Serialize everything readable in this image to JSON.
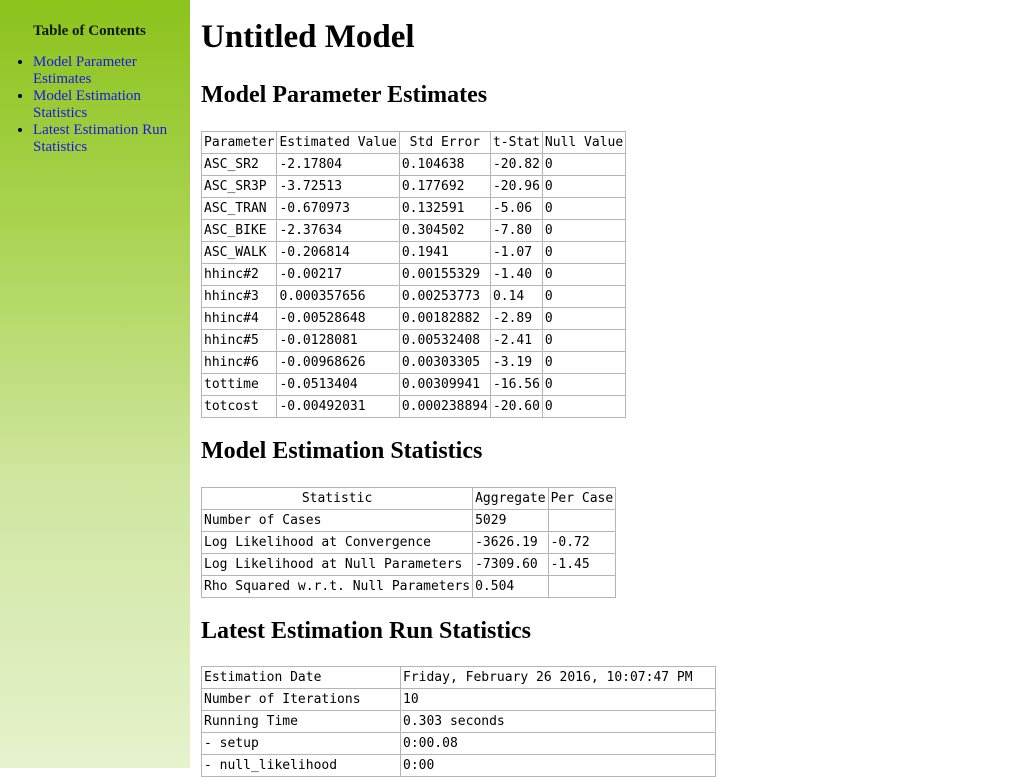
{
  "toc": {
    "title": "Table of Contents",
    "items": [
      {
        "label": "Model Parameter Estimates"
      },
      {
        "label": "Model Estimation Statistics"
      },
      {
        "label": "Latest Estimation Run Statistics"
      }
    ]
  },
  "page_title": "Untitled Model",
  "params": {
    "heading": "Model Parameter Estimates",
    "headers": [
      "Parameter",
      "Estimated Value",
      "Std Error",
      "t-Stat",
      "Null Value"
    ],
    "rows": [
      [
        "ASC_SR2",
        "-2.17804",
        "0.104638",
        "-20.82",
        "0"
      ],
      [
        "ASC_SR3P",
        "-3.72513",
        "0.177692",
        "-20.96",
        "0"
      ],
      [
        "ASC_TRAN",
        "-0.670973",
        "0.132591",
        "-5.06",
        "0"
      ],
      [
        "ASC_BIKE",
        "-2.37634",
        "0.304502",
        "-7.80",
        "0"
      ],
      [
        "ASC_WALK",
        "-0.206814",
        "0.1941",
        "-1.07",
        "0"
      ],
      [
        "hhinc#2",
        "-0.00217",
        "0.00155329",
        "-1.40",
        "0"
      ],
      [
        "hhinc#3",
        "0.000357656",
        "0.00253773",
        "0.14",
        "0"
      ],
      [
        "hhinc#4",
        "-0.00528648",
        "0.00182882",
        "-2.89",
        "0"
      ],
      [
        "hhinc#5",
        "-0.0128081",
        "0.00532408",
        "-2.41",
        "0"
      ],
      [
        "hhinc#6",
        "-0.00968626",
        "0.00303305",
        "-3.19",
        "0"
      ],
      [
        "tottime",
        "-0.0513404",
        "0.00309941",
        "-16.56",
        "0"
      ],
      [
        "totcost",
        "-0.00492031",
        "0.000238894",
        "-20.60",
        "0"
      ]
    ]
  },
  "stats": {
    "heading": "Model Estimation Statistics",
    "headers": [
      "Statistic",
      "Aggregate",
      "Per Case"
    ],
    "rows": [
      [
        "Number of Cases",
        "5029",
        ""
      ],
      [
        "Log Likelihood at Convergence",
        "-3626.19",
        "-0.72"
      ],
      [
        "Log Likelihood at Null Parameters",
        "-7309.60",
        "-1.45"
      ],
      [
        "Rho Squared w.r.t. Null Parameters",
        "0.504",
        ""
      ]
    ]
  },
  "run": {
    "heading": "Latest Estimation Run Statistics",
    "rows": [
      [
        "Estimation Date",
        "Friday, February 26 2016, 10:07:47 PM"
      ],
      [
        "Number of Iterations",
        "10"
      ],
      [
        "Running Time",
        "0.303 seconds"
      ],
      [
        "- setup",
        "0:00.08"
      ],
      [
        "- null_likelihood",
        "0:00"
      ]
    ]
  }
}
